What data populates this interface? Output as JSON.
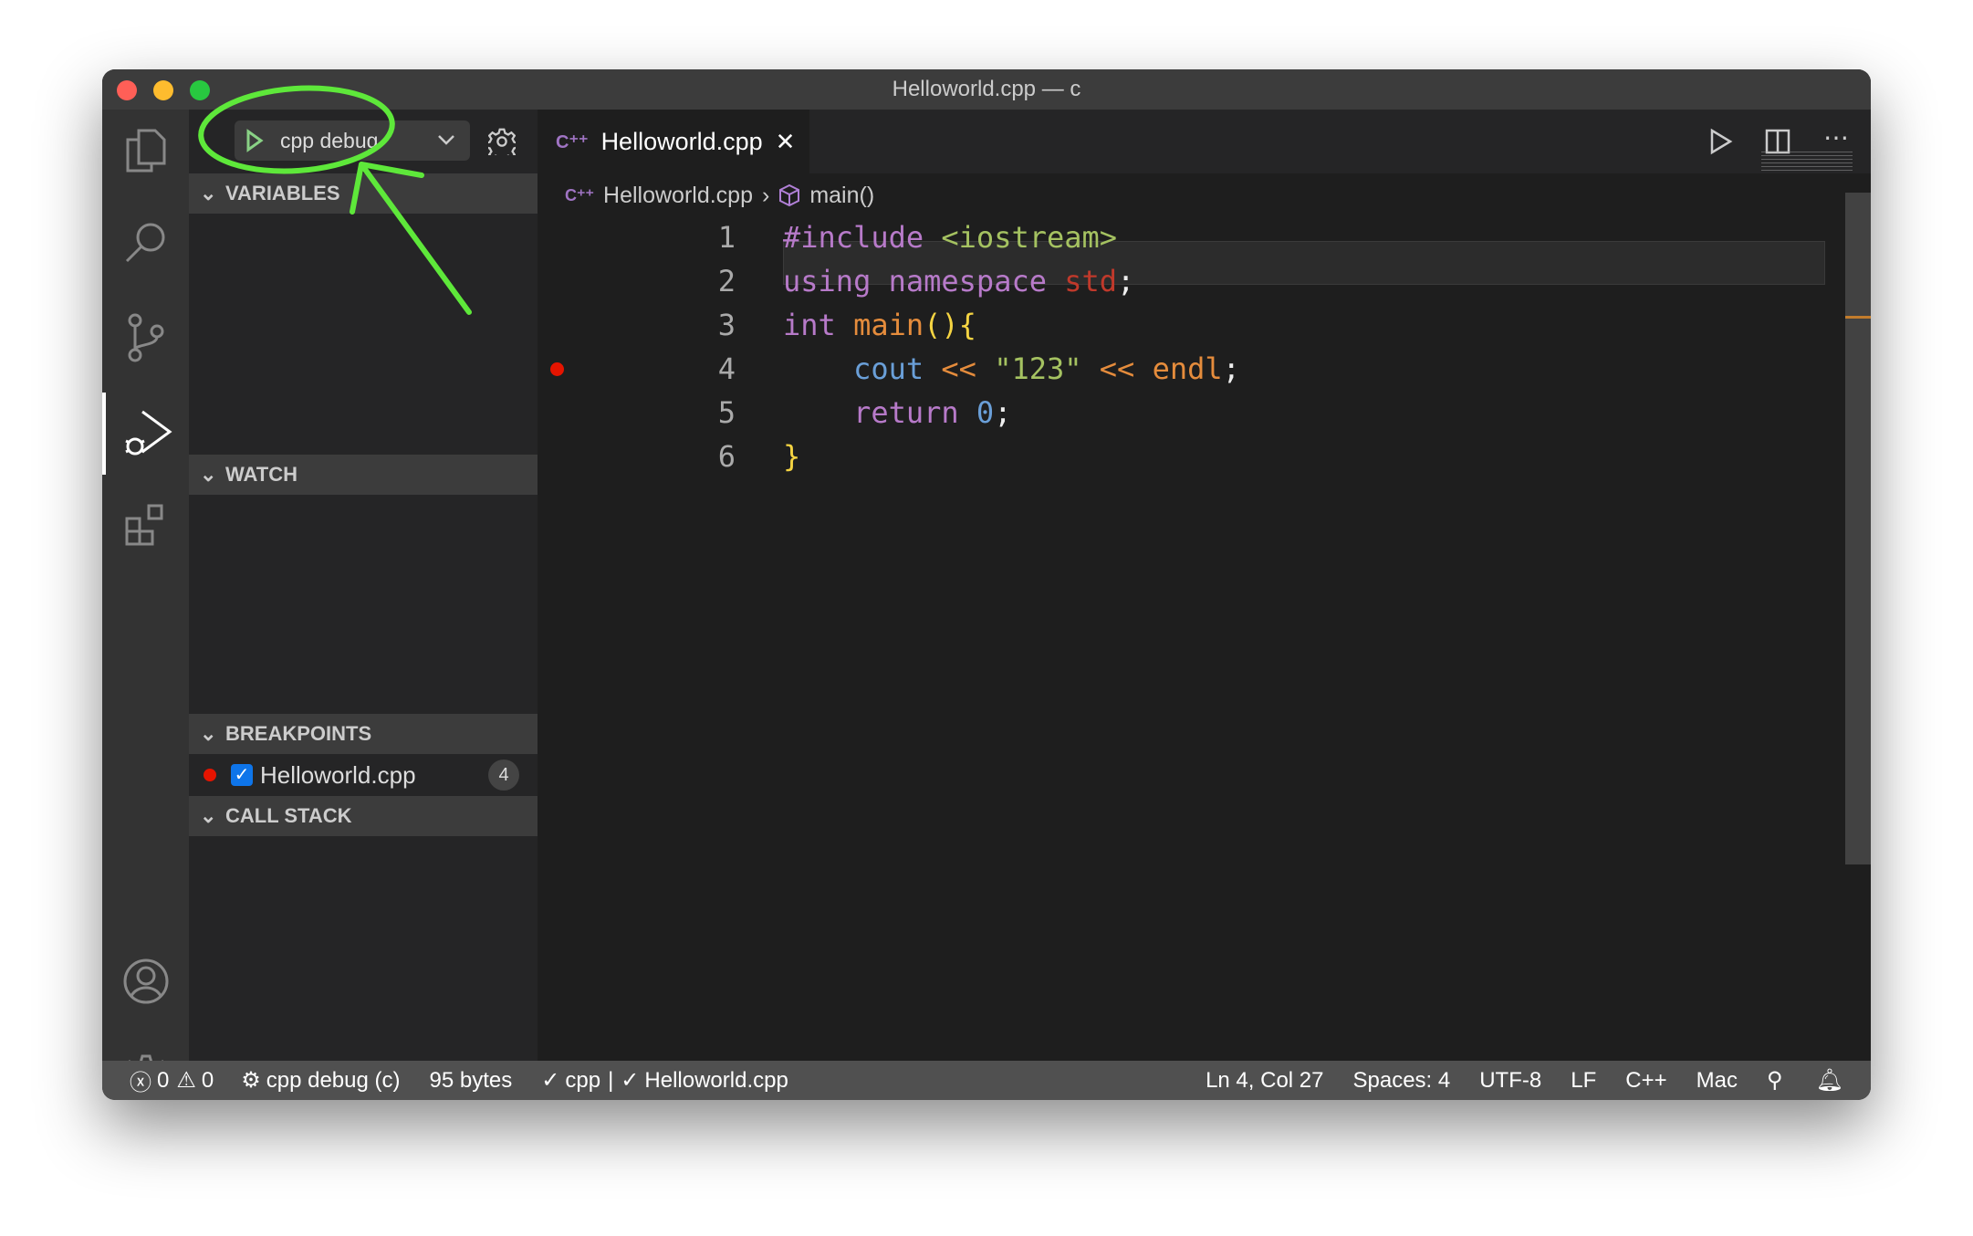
{
  "window": {
    "title": "Helloworld.cpp — c"
  },
  "activity": [
    "explorer-icon",
    "search-icon",
    "source-control-icon",
    "run-debug-icon",
    "extensions-icon",
    "account-icon",
    "settings-gear-icon"
  ],
  "debug": {
    "config": "cpp debug"
  },
  "sidebar": {
    "variables": "VARIABLES",
    "watch": "WATCH",
    "breakpoints": "BREAKPOINTS",
    "call_stack": "CALL STACK",
    "breakpoint_items": [
      {
        "file": "Helloworld.cpp",
        "line": "4",
        "checked": true
      }
    ]
  },
  "editor": {
    "tab": "Helloworld.cpp",
    "breadcrumb": [
      "Helloworld.cpp",
      "main()"
    ],
    "lines": [
      {
        "n": "1",
        "tokens": [
          [
            "kw",
            "#include "
          ],
          [
            "str",
            "<iostream>"
          ]
        ]
      },
      {
        "n": "2",
        "tokens": [
          [
            "kw",
            "using namespace "
          ],
          [
            "std",
            "std"
          ],
          [
            "pl",
            ";"
          ]
        ]
      },
      {
        "n": "3",
        "tokens": [
          [
            "kw",
            "int "
          ],
          [
            "fn",
            "main"
          ],
          [
            "br",
            "()"
          ],
          [
            "br",
            "{"
          ]
        ]
      },
      {
        "n": "4",
        "tokens": [
          [
            "pl",
            "    "
          ],
          [
            "var",
            "cout"
          ],
          [
            "op",
            " << "
          ],
          [
            "str",
            "\"123\""
          ],
          [
            "op",
            " << endl"
          ],
          [
            "pl",
            ";"
          ]
        ]
      },
      {
        "n": "5",
        "tokens": [
          [
            "pl",
            "    "
          ],
          [
            "kw",
            "return "
          ],
          [
            "num",
            "0"
          ],
          [
            "pl",
            ";"
          ]
        ]
      },
      {
        "n": "6",
        "tokens": [
          [
            "br",
            "}"
          ]
        ]
      }
    ],
    "breakpoint_line": "4"
  },
  "status": {
    "errors": "0",
    "warnings": "0",
    "debug": "cpp debug (c)",
    "size": "95 bytes",
    "check1": "cpp",
    "check2": "Helloworld.cpp",
    "position": "Ln 4, Col 27",
    "spaces": "Spaces: 4",
    "encoding": "UTF-8",
    "eol": "LF",
    "language": "C++",
    "platform": "Mac"
  },
  "colors": {
    "annotation": "#5ee83a",
    "breakpoint": "#e51400",
    "accent": "#89d185"
  }
}
